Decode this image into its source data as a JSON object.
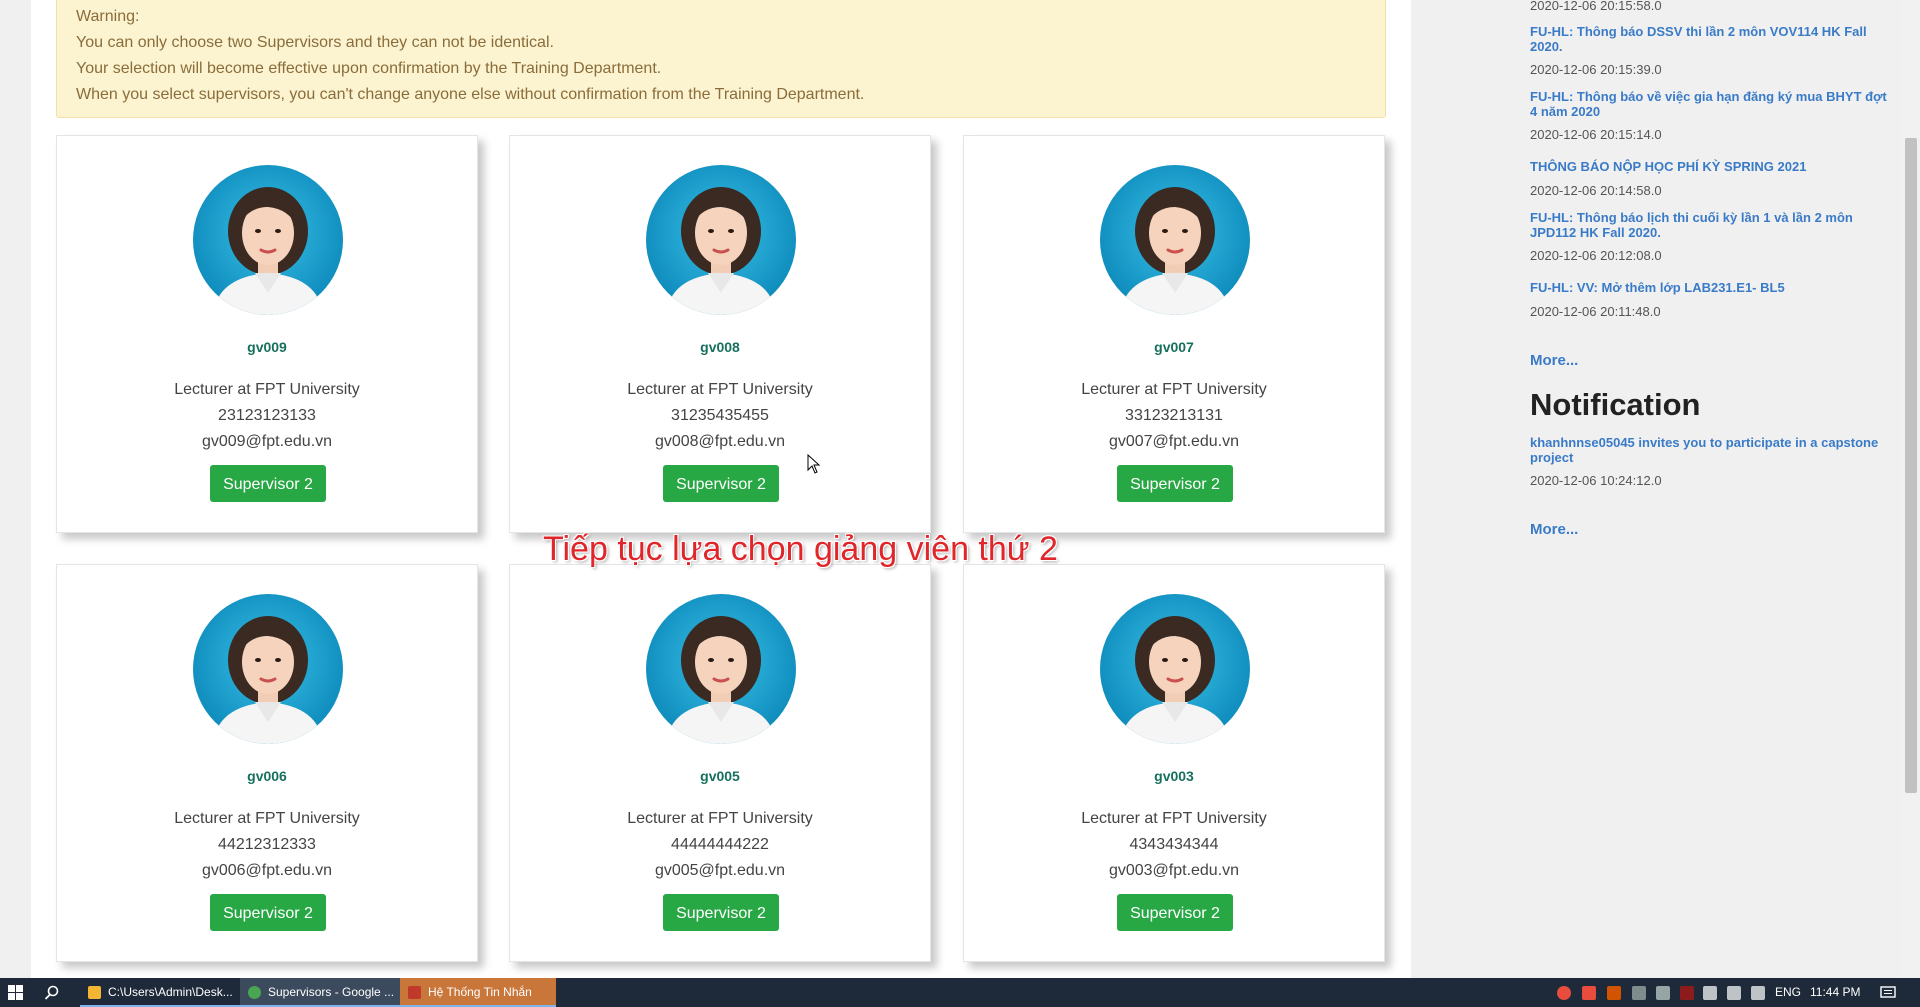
{
  "warning": {
    "lines": [
      "Warning:",
      "You can only choose two Supervisors and they can not be identical.",
      "Your selection will become effective upon confirmation by the Training Department.",
      "When you select supervisors, you can't change anyone else without confirmation from the Training Department."
    ]
  },
  "supervisors": [
    {
      "username": "gv009",
      "title": "Lecturer at FPT University",
      "phone": "23123123133",
      "email": "gv009@fpt.edu.vn",
      "button": "Supervisor 2"
    },
    {
      "username": "gv008",
      "title": "Lecturer at FPT University",
      "phone": "31235435455",
      "email": "gv008@fpt.edu.vn",
      "button": "Supervisor 2"
    },
    {
      "username": "gv007",
      "title": "Lecturer at FPT University",
      "phone": "33123213131",
      "email": "gv007@fpt.edu.vn",
      "button": "Supervisor 2"
    },
    {
      "username": "gv006",
      "title": "Lecturer at FPT University",
      "phone": "44212312333",
      "email": "gv006@fpt.edu.vn",
      "button": "Supervisor 2"
    },
    {
      "username": "gv005",
      "title": "Lecturer at FPT University",
      "phone": "44444444222",
      "email": "gv005@fpt.edu.vn",
      "button": "Supervisor 2"
    },
    {
      "username": "gv003",
      "title": "Lecturer at FPT University",
      "phone": "4343434344",
      "email": "gv003@fpt.edu.vn",
      "button": "Supervisor 2"
    }
  ],
  "overlay_caption": "Tiếp tục lựa chọn giảng viên thứ 2",
  "sidebar": {
    "top_date": "2020-12-06 20:15:58.0",
    "news": [
      {
        "title": "FU-HL: Thông báo DSSV thi lần 2 môn VOV114 HK Fall 2020.",
        "date": "2020-12-06 20:15:39.0"
      },
      {
        "title": "FU-HL: Thông báo về việc gia hạn đăng ký mua BHYT đợt 4 năm 2020",
        "date": "2020-12-06 20:15:14.0"
      },
      {
        "title": "THÔNG BÁO NỘP HỌC PHÍ KỲ SPRING 2021",
        "date": "2020-12-06 20:14:58.0"
      },
      {
        "title": "FU-HL: Thông báo lịch thi cuối kỳ lần 1 và lần 2 môn JPD112 HK Fall 2020.",
        "date": "2020-12-06 20:12:08.0"
      },
      {
        "title": "FU-HL: VV: Mở thêm lớp LAB231.E1- BL5",
        "date": "2020-12-06 20:11:48.0"
      }
    ],
    "news_more": "More...",
    "notification_title": "Notification",
    "notifications": [
      {
        "title": "khanhnnse05045 invites you to participate in a capstone project",
        "date": "2020-12-06 10:24:12.0"
      }
    ],
    "notification_more": "More..."
  },
  "taskbar": {
    "tasks": [
      {
        "label": "C:\\Users\\Admin\\Desk...",
        "color": "#f2b632"
      },
      {
        "label": "Supervisors - Google ...",
        "color": "#4aa552"
      },
      {
        "label": "Hệ Thống Tin Nhắn",
        "color": "#c0392b"
      }
    ],
    "language": "ENG",
    "clock": "11:44 PM"
  },
  "colors": {
    "button_green": "#28a745",
    "link_blue": "#3a7bc8",
    "warning_bg": "#fcf3d0",
    "caption_red": "#e0262a"
  }
}
